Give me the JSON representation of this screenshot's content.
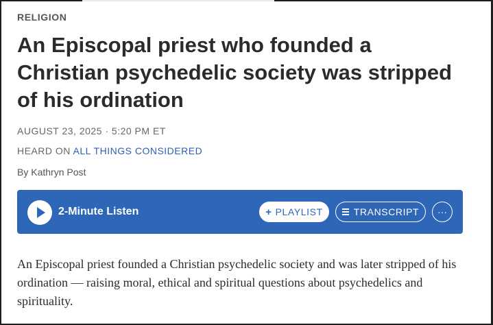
{
  "article": {
    "section": "RELIGION",
    "headline": "An Episcopal priest who founded a Christian psychedelic society was stripped of his ordination",
    "date": "AUGUST 23, 2025 · 5:20 PM ET",
    "heard_on_prefix": "HEARD ON",
    "program": "ALL THINGS CONSIDERED",
    "byline_prefix": "By",
    "author": "Kathryn Post",
    "summary": "An Episcopal priest founded a Christian psychedelic society and was later stripped of his ordination — raising moral, ethical and spiritual questions about psychedelics and spirituality."
  },
  "player": {
    "listen_label": "2-Minute Listen",
    "playlist_label": "PLAYLIST",
    "transcript_label": "TRANSCRIPT",
    "more_label": "···",
    "icons": [
      "play-icon",
      "plus-icon",
      "transcript-lines-icon",
      "more-icon"
    ]
  },
  "colors": {
    "player_bg": "#2e67b8",
    "link": "#2f5fb5"
  }
}
